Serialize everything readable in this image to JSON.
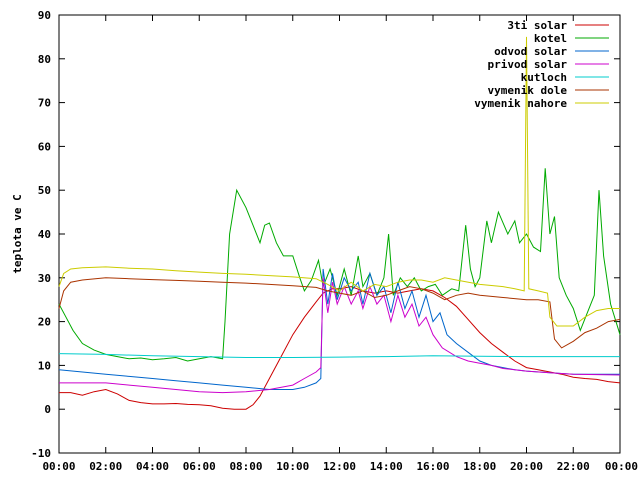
{
  "chart_data": {
    "type": "line",
    "title": "",
    "xlabel": "",
    "ylabel": "teplota ve C",
    "ylim": [
      -10,
      90
    ],
    "xlim": [
      0,
      24
    ],
    "x_ticks": [
      0,
      2,
      4,
      6,
      8,
      10,
      12,
      14,
      16,
      18,
      20,
      22,
      24
    ],
    "x_tick_labels": [
      "00:00",
      "02:00",
      "04:00",
      "06:00",
      "08:00",
      "10:00",
      "12:00",
      "14:00",
      "16:00",
      "18:00",
      "20:00",
      "22:00",
      "00:00"
    ],
    "y_ticks": [
      -10,
      0,
      10,
      20,
      30,
      40,
      50,
      60,
      70,
      80,
      90
    ],
    "y_tick_labels": [
      "-10",
      "0",
      "10",
      "20",
      "30",
      "40",
      "50",
      "60",
      "70",
      "80",
      "90"
    ],
    "grid": false,
    "legend_position": "top-right",
    "series": [
      {
        "name": "3ti solar",
        "color": "#cc0000",
        "points": [
          [
            0,
            3.8
          ],
          [
            0.5,
            3.8
          ],
          [
            1,
            3.2
          ],
          [
            1.5,
            4.0
          ],
          [
            2,
            4.5
          ],
          [
            2.5,
            3.5
          ],
          [
            3,
            2.0
          ],
          [
            3.5,
            1.5
          ],
          [
            4,
            1.2
          ],
          [
            4.5,
            1.2
          ],
          [
            5,
            1.3
          ],
          [
            5.5,
            1.1
          ],
          [
            6,
            1.0
          ],
          [
            6.5,
            0.8
          ],
          [
            7,
            0.2
          ],
          [
            7.5,
            0.0
          ],
          [
            8,
            0.0
          ],
          [
            8.3,
            1.0
          ],
          [
            8.6,
            3.0
          ],
          [
            9,
            7.0
          ],
          [
            9.5,
            12.0
          ],
          [
            10,
            17.0
          ],
          [
            10.5,
            21.0
          ],
          [
            11,
            24.5
          ],
          [
            11.3,
            26.5
          ],
          [
            11.7,
            27.5
          ],
          [
            12,
            27.5
          ],
          [
            12.5,
            28.0
          ],
          [
            13,
            27.0
          ],
          [
            13.5,
            26.5
          ],
          [
            14,
            27.0
          ],
          [
            14.5,
            26.5
          ],
          [
            15,
            27.0
          ],
          [
            15.5,
            27.5
          ],
          [
            16,
            27.0
          ],
          [
            16.5,
            25.5
          ],
          [
            17,
            23.5
          ],
          [
            17.5,
            20.5
          ],
          [
            18,
            17.5
          ],
          [
            18.5,
            15.0
          ],
          [
            19,
            13.0
          ],
          [
            19.5,
            11.0
          ],
          [
            20,
            9.5
          ],
          [
            20.5,
            9.0
          ],
          [
            21,
            8.5
          ],
          [
            21.5,
            8.0
          ],
          [
            22,
            7.3
          ],
          [
            22.5,
            7.0
          ],
          [
            23,
            6.8
          ],
          [
            23.5,
            6.3
          ],
          [
            24,
            6.0
          ]
        ]
      },
      {
        "name": "kotel",
        "color": "#00aa00",
        "points": [
          [
            0,
            24.0
          ],
          [
            0.3,
            21.0
          ],
          [
            0.6,
            18.0
          ],
          [
            1,
            15.0
          ],
          [
            1.5,
            13.5
          ],
          [
            2,
            12.5
          ],
          [
            2.5,
            12.0
          ],
          [
            3,
            11.5
          ],
          [
            3.5,
            11.7
          ],
          [
            4,
            11.3
          ],
          [
            4.5,
            11.5
          ],
          [
            5,
            11.8
          ],
          [
            5.5,
            11.0
          ],
          [
            6,
            11.5
          ],
          [
            6.5,
            12.0
          ],
          [
            7,
            11.5
          ],
          [
            7.1,
            20.0
          ],
          [
            7.3,
            40.0
          ],
          [
            7.6,
            50.0
          ],
          [
            8,
            46.0
          ],
          [
            8.3,
            42.0
          ],
          [
            8.6,
            38.0
          ],
          [
            8.8,
            42.0
          ],
          [
            9,
            42.5
          ],
          [
            9.3,
            38.0
          ],
          [
            9.6,
            35.0
          ],
          [
            10,
            35.0
          ],
          [
            10.3,
            30.0
          ],
          [
            10.5,
            27.0
          ],
          [
            10.8,
            29.5
          ],
          [
            11.1,
            34.0
          ],
          [
            11.3,
            28.0
          ],
          [
            11.6,
            32.0
          ],
          [
            11.9,
            26.0
          ],
          [
            12.2,
            32.0
          ],
          [
            12.5,
            26.0
          ],
          [
            12.8,
            35.0
          ],
          [
            13.0,
            28.0
          ],
          [
            13.3,
            31.0
          ],
          [
            13.6,
            26.0
          ],
          [
            13.9,
            30.0
          ],
          [
            14.1,
            40.0
          ],
          [
            14.3,
            26.0
          ],
          [
            14.6,
            30.0
          ],
          [
            14.9,
            28.0
          ],
          [
            15.2,
            30.0
          ],
          [
            15.5,
            27.0
          ],
          [
            15.8,
            28.0
          ],
          [
            16.1,
            28.5
          ],
          [
            16.4,
            26.0
          ],
          [
            16.8,
            27.5
          ],
          [
            17.1,
            27.0
          ],
          [
            17.4,
            42.0
          ],
          [
            17.6,
            32.0
          ],
          [
            17.8,
            28.0
          ],
          [
            18.0,
            30.0
          ],
          [
            18.3,
            43.0
          ],
          [
            18.5,
            38.0
          ],
          [
            18.8,
            45.0
          ],
          [
            19.2,
            40.0
          ],
          [
            19.5,
            43.0
          ],
          [
            19.7,
            38.0
          ],
          [
            20.0,
            40.0
          ],
          [
            20.3,
            37.0
          ],
          [
            20.6,
            36.0
          ],
          [
            20.8,
            55.0
          ],
          [
            21.0,
            40.0
          ],
          [
            21.2,
            44.0
          ],
          [
            21.4,
            30.0
          ],
          [
            21.7,
            26.0
          ],
          [
            22.0,
            23.0
          ],
          [
            22.3,
            18.0
          ],
          [
            22.6,
            22.0
          ],
          [
            22.9,
            26.0
          ],
          [
            23.1,
            50.0
          ],
          [
            23.3,
            35.0
          ],
          [
            23.6,
            24.0
          ],
          [
            24,
            17.0
          ]
        ]
      },
      {
        "name": "odvod solar",
        "color": "#0066cc",
        "points": [
          [
            0,
            9.0
          ],
          [
            1,
            8.5
          ],
          [
            2,
            8.0
          ],
          [
            3,
            7.5
          ],
          [
            4,
            7.0
          ],
          [
            5,
            6.5
          ],
          [
            6,
            6.0
          ],
          [
            7,
            5.5
          ],
          [
            8,
            5.0
          ],
          [
            9,
            4.5
          ],
          [
            10,
            4.5
          ],
          [
            10.5,
            5.0
          ],
          [
            11,
            6.0
          ],
          [
            11.2,
            7.0
          ],
          [
            11.3,
            32.0
          ],
          [
            11.5,
            24.0
          ],
          [
            11.7,
            31.0
          ],
          [
            11.9,
            25.0
          ],
          [
            12.2,
            30.0
          ],
          [
            12.5,
            27.0
          ],
          [
            12.8,
            29.0
          ],
          [
            13.0,
            24.0
          ],
          [
            13.3,
            31.0
          ],
          [
            13.6,
            26.0
          ],
          [
            13.9,
            28.0
          ],
          [
            14.2,
            22.0
          ],
          [
            14.5,
            29.0
          ],
          [
            14.8,
            23.0
          ],
          [
            15.1,
            27.0
          ],
          [
            15.4,
            21.0
          ],
          [
            15.7,
            26.0
          ],
          [
            16.0,
            20.0
          ],
          [
            16.3,
            22.0
          ],
          [
            16.6,
            17.0
          ],
          [
            17.0,
            15.0
          ],
          [
            17.5,
            13.0
          ],
          [
            18,
            11.0
          ],
          [
            18.5,
            10.0
          ],
          [
            19,
            9.5
          ],
          [
            19.5,
            9.0
          ],
          [
            20,
            8.7
          ],
          [
            21,
            8.3
          ],
          [
            22,
            8.0
          ],
          [
            23,
            8.0
          ],
          [
            24,
            8.0
          ]
        ]
      },
      {
        "name": "privod solar",
        "color": "#cc00cc",
        "points": [
          [
            0,
            6.0
          ],
          [
            1,
            6.0
          ],
          [
            2,
            6.0
          ],
          [
            3,
            5.5
          ],
          [
            4,
            5.0
          ],
          [
            5,
            4.5
          ],
          [
            6,
            4.0
          ],
          [
            7,
            3.8
          ],
          [
            8,
            4.0
          ],
          [
            9,
            4.5
          ],
          [
            10,
            5.5
          ],
          [
            10.5,
            7.0
          ],
          [
            11,
            8.5
          ],
          [
            11.2,
            9.5
          ],
          [
            11.3,
            30.0
          ],
          [
            11.5,
            22.0
          ],
          [
            11.7,
            29.0
          ],
          [
            11.9,
            24.0
          ],
          [
            12.2,
            28.0
          ],
          [
            12.5,
            24.0
          ],
          [
            12.8,
            27.0
          ],
          [
            13.0,
            23.0
          ],
          [
            13.3,
            28.0
          ],
          [
            13.6,
            24.0
          ],
          [
            13.9,
            26.0
          ],
          [
            14.2,
            20.0
          ],
          [
            14.5,
            26.0
          ],
          [
            14.8,
            21.0
          ],
          [
            15.1,
            24.0
          ],
          [
            15.4,
            19.0
          ],
          [
            15.7,
            21.0
          ],
          [
            16.0,
            17.0
          ],
          [
            16.4,
            14.0
          ],
          [
            17,
            12.0
          ],
          [
            17.5,
            11.0
          ],
          [
            18,
            10.5
          ],
          [
            18.5,
            10.0
          ],
          [
            19,
            9.3
          ],
          [
            19.5,
            9.0
          ],
          [
            20,
            8.7
          ],
          [
            21,
            8.3
          ],
          [
            22,
            8.0
          ],
          [
            23,
            7.9
          ],
          [
            24,
            7.8
          ]
        ]
      },
      {
        "name": "kutloch",
        "color": "#00cccc",
        "points": [
          [
            0,
            12.7
          ],
          [
            2,
            12.5
          ],
          [
            4,
            12.2
          ],
          [
            6,
            12.0
          ],
          [
            8,
            11.8
          ],
          [
            10,
            11.8
          ],
          [
            12,
            11.9
          ],
          [
            14,
            12.0
          ],
          [
            16,
            12.2
          ],
          [
            18,
            12.1
          ],
          [
            20,
            12.0
          ],
          [
            22,
            12.0
          ],
          [
            24,
            12.0
          ]
        ]
      },
      {
        "name": "vymenik dole",
        "color": "#aa3300",
        "points": [
          [
            0,
            23.0
          ],
          [
            0.2,
            27.0
          ],
          [
            0.5,
            29.0
          ],
          [
            1,
            29.5
          ],
          [
            2,
            30.0
          ],
          [
            3,
            29.8
          ],
          [
            4,
            29.6
          ],
          [
            5,
            29.4
          ],
          [
            6,
            29.2
          ],
          [
            7,
            29.0
          ],
          [
            8,
            28.8
          ],
          [
            9,
            28.5
          ],
          [
            10,
            28.2
          ],
          [
            11,
            27.8
          ],
          [
            11.5,
            27.0
          ],
          [
            12,
            26.5
          ],
          [
            12.5,
            26.0
          ],
          [
            13,
            27.0
          ],
          [
            13.5,
            25.5
          ],
          [
            14,
            26.0
          ],
          [
            14.5,
            27.0
          ],
          [
            15,
            28.0
          ],
          [
            15.5,
            27.5
          ],
          [
            16,
            26.5
          ],
          [
            16.5,
            25.0
          ],
          [
            17,
            26.0
          ],
          [
            17.5,
            26.5
          ],
          [
            18,
            26.0
          ],
          [
            19,
            25.5
          ],
          [
            20,
            25.0
          ],
          [
            20.5,
            25.0
          ],
          [
            21,
            24.5
          ],
          [
            21.2,
            16.0
          ],
          [
            21.5,
            14.0
          ],
          [
            22,
            15.5
          ],
          [
            22.5,
            17.5
          ],
          [
            23,
            18.5
          ],
          [
            23.5,
            20.0
          ],
          [
            24,
            20.5
          ]
        ]
      },
      {
        "name": "vymenik nahore",
        "color": "#cccc00",
        "points": [
          [
            0,
            28.0
          ],
          [
            0.2,
            31.0
          ],
          [
            0.5,
            32.0
          ],
          [
            1,
            32.3
          ],
          [
            2,
            32.5
          ],
          [
            3,
            32.2
          ],
          [
            4,
            32.0
          ],
          [
            5,
            31.6
          ],
          [
            6,
            31.3
          ],
          [
            7,
            31.0
          ],
          [
            8,
            30.8
          ],
          [
            9,
            30.5
          ],
          [
            10,
            30.2
          ],
          [
            11,
            29.8
          ],
          [
            11.5,
            28.5
          ],
          [
            12,
            27.0
          ],
          [
            12.5,
            29.0
          ],
          [
            13,
            27.0
          ],
          [
            13.5,
            28.5
          ],
          [
            14,
            28.0
          ],
          [
            14.5,
            29.0
          ],
          [
            15,
            29.5
          ],
          [
            15.5,
            29.5
          ],
          [
            16,
            29.0
          ],
          [
            16.5,
            30.0
          ],
          [
            17,
            29.5
          ],
          [
            18,
            28.5
          ],
          [
            19,
            28.0
          ],
          [
            19.5,
            27.5
          ],
          [
            19.9,
            27.0
          ],
          [
            20.0,
            85.0
          ],
          [
            20.1,
            27.5
          ],
          [
            20.5,
            27.0
          ],
          [
            20.9,
            26.5
          ],
          [
            21.0,
            21.0
          ],
          [
            21.3,
            19.0
          ],
          [
            22,
            19.0
          ],
          [
            22.5,
            21.0
          ],
          [
            23,
            22.5
          ],
          [
            23.5,
            23.0
          ],
          [
            24,
            23.0
          ]
        ]
      }
    ]
  }
}
